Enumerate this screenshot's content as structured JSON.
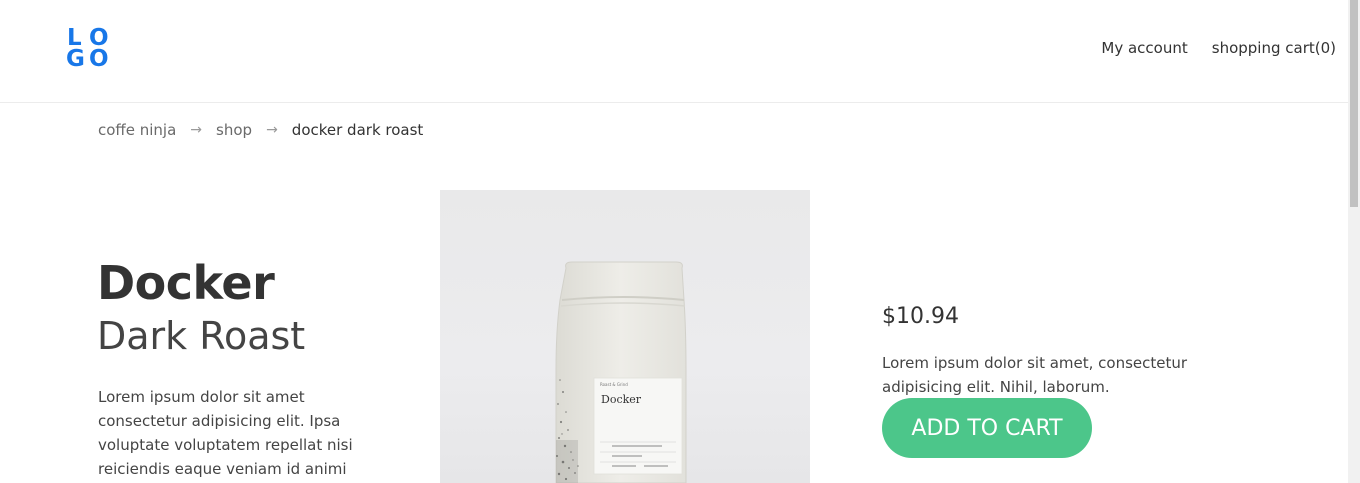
{
  "header": {
    "logo_letters": [
      "L",
      "O",
      "G",
      "O"
    ],
    "nav": {
      "account": "My account",
      "cart": "shopping cart(0)"
    }
  },
  "breadcrumb": {
    "items": [
      "coffe ninja",
      "shop",
      "docker dark roast"
    ],
    "separator": "→"
  },
  "product": {
    "name": "Docker",
    "subtitle": "Dark Roast",
    "short_description": "Lorem ipsum dolor sit amet consectetur adipisicing elit. Ipsa voluptate voluptatem repellat nisi reiciendis eaque veniam id animi",
    "price": "$10.94",
    "description": "Lorem ipsum dolor sit amet, consectetur adipisicing elit. Nihil, laborum.",
    "add_to_cart_label": "ADD TO CART",
    "image": {
      "bag_label_name": "Docker"
    }
  },
  "colors": {
    "logo": "#1877e8",
    "cta": "#4cc68a",
    "text": "#333333"
  }
}
